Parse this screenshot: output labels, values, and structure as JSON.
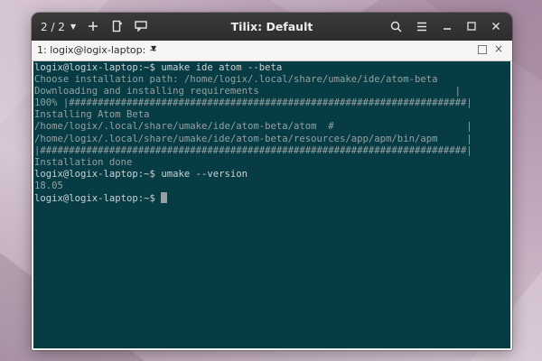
{
  "window": {
    "title": "Tilix: Default",
    "session_counter": "2 / 2"
  },
  "icons": {
    "session_caret": "chevron-down-icon",
    "add_terminal": "plus-icon",
    "split_terminal": "split-icon",
    "notifications": "notification-icon",
    "search": "search-icon",
    "menu": "hamburger-menu-icon",
    "minimize": "minimize-icon",
    "maximize": "maximize-icon",
    "close": "close-icon"
  },
  "tab": {
    "label": "1: logix@logix-laptop: ~"
  },
  "terminal": {
    "background": "#083c45",
    "lines": [
      "logix@logix-laptop:~$ umake ide atom --beta",
      "Choose installation path: /home/logix/.local/share/umake/ide/atom-beta",
      "Downloading and installing requirements                                  |",
      "100% |#####################################################################|",
      "Installing Atom Beta",
      "/home/logix/.local/share/umake/ide/atom-beta/atom  #                       |",
      "/home/logix/.local/share/umake/ide/atom-beta/resources/app/apm/bin/apm     |",
      "|##########################################################################|",
      "Installation done",
      "logix@logix-laptop:~$ umake --version",
      "18.05",
      "logix@logix-laptop:~$ "
    ]
  }
}
